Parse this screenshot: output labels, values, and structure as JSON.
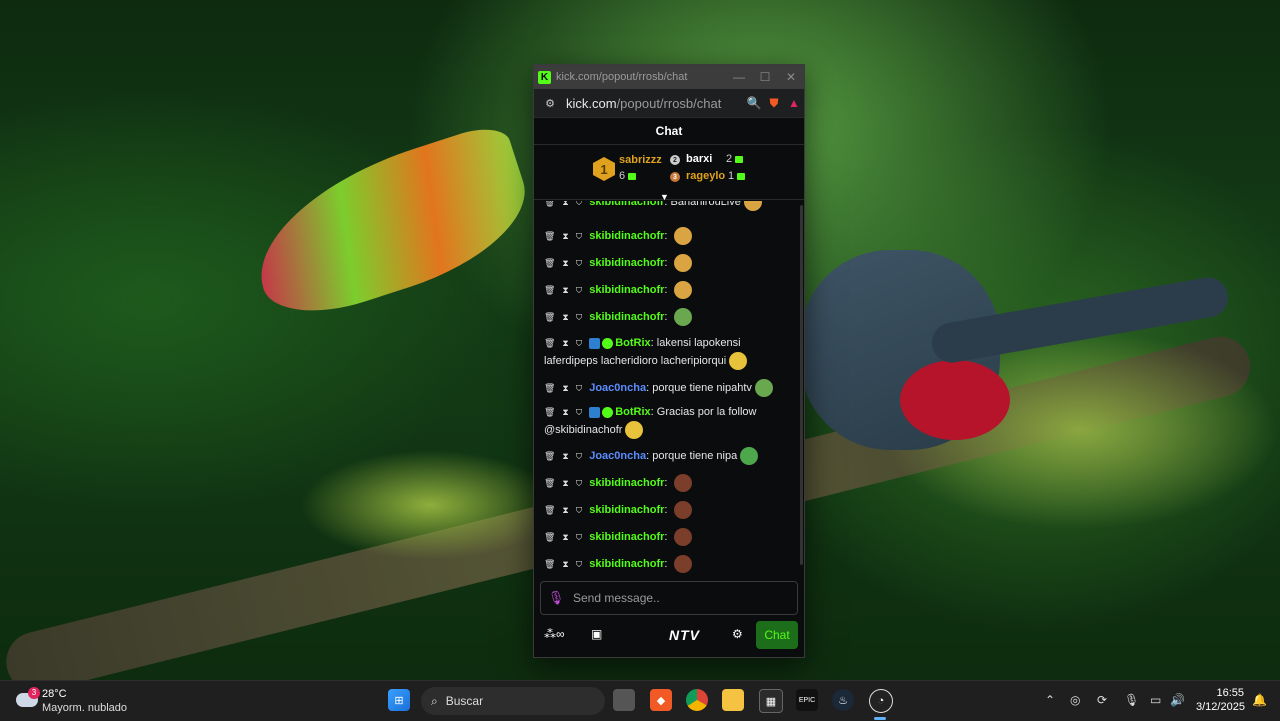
{
  "window": {
    "title": "kick.com/popout/rrosb/chat",
    "url_host": "kick.com",
    "url_path": "/popout/rrosb/chat"
  },
  "chat_header": "Chat",
  "leaderboard": {
    "first": {
      "rank": "1",
      "name": "sabrizzz",
      "count": "6"
    },
    "second": {
      "name": "barxi",
      "count": "2"
    },
    "third": {
      "name": "rageylo",
      "count": "1"
    }
  },
  "messages": [
    {
      "user": "skibidinachofr",
      "text": "BananirouLive",
      "color": "green",
      "partial": true
    },
    {
      "user": "skibidinachofr",
      "text": "",
      "color": "green"
    },
    {
      "user": "skibidinachofr",
      "text": "",
      "color": "green"
    },
    {
      "user": "skibidinachofr",
      "text": "",
      "color": "green"
    },
    {
      "user": "skibidinachofr",
      "text": "",
      "color": "green"
    },
    {
      "user": "BotRix",
      "text": "lakensi lapokensi laferdipeps lacheridioro lacheripiorqui",
      "color": "green",
      "bot": true
    },
    {
      "user": "Joac0ncha",
      "text": "porque tiene nipahtv",
      "color": "blue"
    },
    {
      "user": "BotRix",
      "text": "Gracias por la follow @skibidinachofr",
      "color": "green",
      "bot": true
    },
    {
      "user": "Joac0ncha",
      "text": "porque tiene nipa",
      "color": "blue"
    },
    {
      "user": "skibidinachofr",
      "text": "",
      "color": "green"
    },
    {
      "user": "skibidinachofr",
      "text": "",
      "color": "green"
    },
    {
      "user": "skibidinachofr",
      "text": "",
      "color": "green"
    },
    {
      "user": "skibidinachofr",
      "text": "",
      "color": "green"
    }
  ],
  "input": {
    "placeholder": "Send message.."
  },
  "footer": {
    "ntv": "NTV",
    "chat_button": "Chat"
  },
  "taskbar": {
    "weather_temp": "28°C",
    "weather_desc": "Mayorm. nublado",
    "weather_badge": "3",
    "search_label": "Buscar",
    "time": "16:55",
    "date": "3/12/2025"
  },
  "colors": {
    "kick_green": "#53fc18",
    "user_blue": "#5b8cff",
    "gold": "#e0a21e"
  }
}
